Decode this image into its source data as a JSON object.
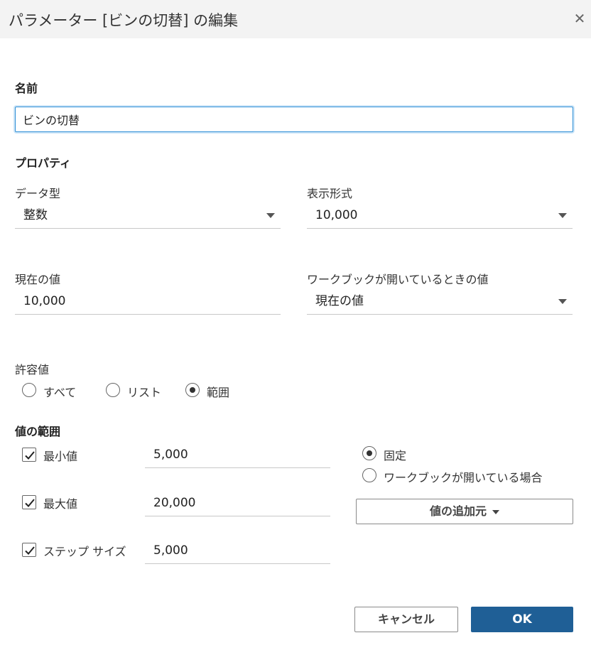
{
  "dialog": {
    "title": "パラメーター [ビンの切替] の編集",
    "close_icon": "close-icon"
  },
  "name": {
    "label": "名前",
    "value": "ビンの切替"
  },
  "properties": {
    "heading": "プロパティ",
    "data_type": {
      "label": "データ型",
      "value": "整数"
    },
    "display_format": {
      "label": "表示形式",
      "value": "10,000"
    },
    "current_value": {
      "label": "現在の値",
      "value": "10,000"
    },
    "on_open": {
      "label": "ワークブックが開いているときの値",
      "value": "現在の値"
    }
  },
  "allowed_values": {
    "label": "許容値",
    "options": [
      {
        "label": "すべて",
        "selected": false
      },
      {
        "label": "リスト",
        "selected": false
      },
      {
        "label": "範囲",
        "selected": true
      }
    ]
  },
  "range": {
    "heading": "値の範囲",
    "min": {
      "label": "最小値",
      "checked": true,
      "value": "5,000"
    },
    "max": {
      "label": "最大値",
      "checked": true,
      "value": "20,000"
    },
    "step": {
      "label": "ステップ サイズ",
      "checked": true,
      "value": "5,000"
    },
    "mode_options": [
      {
        "label": "固定",
        "selected": true
      },
      {
        "label": "ワークブックが開いている場合",
        "selected": false
      }
    ],
    "add_from_label": "値の追加元"
  },
  "footer": {
    "cancel_label": "キャンセル",
    "ok_label": "OK"
  },
  "colors": {
    "primary": "#1f5f96",
    "focus": "#2e8fd6",
    "titlebar": "#f3f3f3"
  }
}
